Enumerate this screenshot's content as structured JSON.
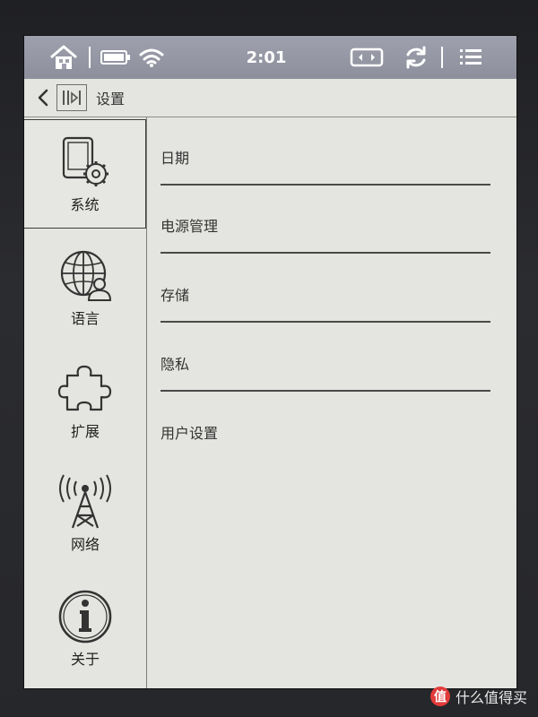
{
  "device": {
    "bezel_color": "#2a2b2f",
    "screen_color": "#e4e4e0"
  },
  "status_bar": {
    "time": "2:01",
    "icons": [
      "home-icon",
      "battery-icon",
      "wifi-icon",
      "rotate-screen-icon",
      "refresh-icon",
      "menu-icon"
    ],
    "background": "#9ea0ad"
  },
  "title_bar": {
    "title": "设置",
    "icons": [
      "back-arrow-icon",
      "app-switch-icon"
    ]
  },
  "sidebar": {
    "selected": "system",
    "items": [
      {
        "id": "system",
        "label": "系统",
        "icon": "device-settings-icon"
      },
      {
        "id": "language",
        "label": "语言",
        "icon": "globe-user-icon"
      },
      {
        "id": "extensions",
        "label": "扩展",
        "icon": "puzzle-icon"
      },
      {
        "id": "network",
        "label": "网络",
        "icon": "antenna-icon"
      },
      {
        "id": "about",
        "label": "关于",
        "icon": "info-icon"
      }
    ]
  },
  "content": {
    "items": [
      {
        "label": "日期"
      },
      {
        "label": "电源管理"
      },
      {
        "label": "存储"
      },
      {
        "label": "隐私"
      },
      {
        "label": "用户设置"
      }
    ]
  },
  "watermark": {
    "logo_text": "值",
    "text": "什么值得买",
    "logo_color": "#e23b3b"
  }
}
